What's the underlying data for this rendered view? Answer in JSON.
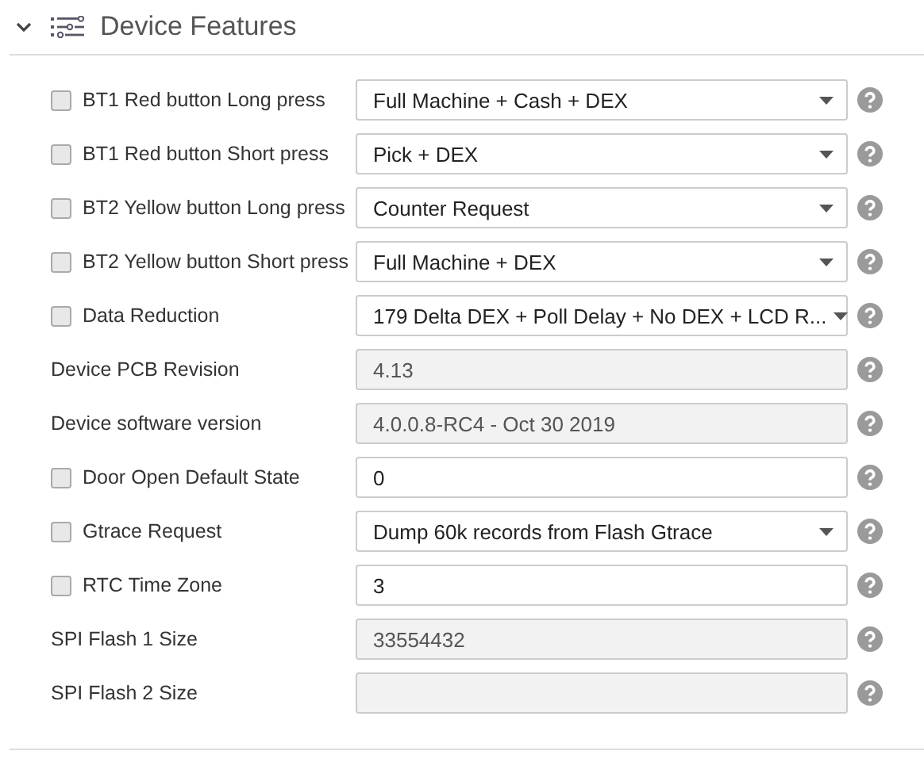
{
  "section": {
    "title": "Device Features",
    "expanded": true
  },
  "rows": [
    {
      "label": "BT1 Red button Long press",
      "checkbox": {
        "checked": false
      },
      "kind": "select",
      "value": "Full Machine + Cash + DEX"
    },
    {
      "label": "BT1 Red button Short press",
      "checkbox": {
        "checked": false
      },
      "kind": "select",
      "value": "Pick + DEX"
    },
    {
      "label": "BT2 Yellow button Long press",
      "checkbox": {
        "checked": false
      },
      "kind": "select",
      "value": "Counter Request"
    },
    {
      "label": "BT2 Yellow button Short press",
      "checkbox": {
        "checked": false
      },
      "kind": "select",
      "value": "Full Machine + DEX"
    },
    {
      "label": "Data Reduction",
      "checkbox": {
        "checked": false
      },
      "kind": "select",
      "value": "179 Delta DEX + Poll Delay + No DEX + LCD R..."
    },
    {
      "label": "Device PCB Revision",
      "kind": "readonly",
      "value": "4.13"
    },
    {
      "label": "Device software version",
      "kind": "readonly",
      "value": "4.0.0.8-RC4 - Oct 30 2019"
    },
    {
      "label": "Door Open Default State",
      "checkbox": {
        "checked": false
      },
      "kind": "text",
      "value": "0"
    },
    {
      "label": "Gtrace Request",
      "checkbox": {
        "checked": false
      },
      "kind": "select",
      "value": "Dump 60k records from Flash Gtrace"
    },
    {
      "label": "RTC Time Zone",
      "checkbox": {
        "checked": false
      },
      "kind": "text",
      "value": "3"
    },
    {
      "label": "SPI Flash 1 Size",
      "kind": "readonly",
      "value": "33554432"
    },
    {
      "label": "SPI Flash 2 Size",
      "kind": "readonly"
    }
  ]
}
